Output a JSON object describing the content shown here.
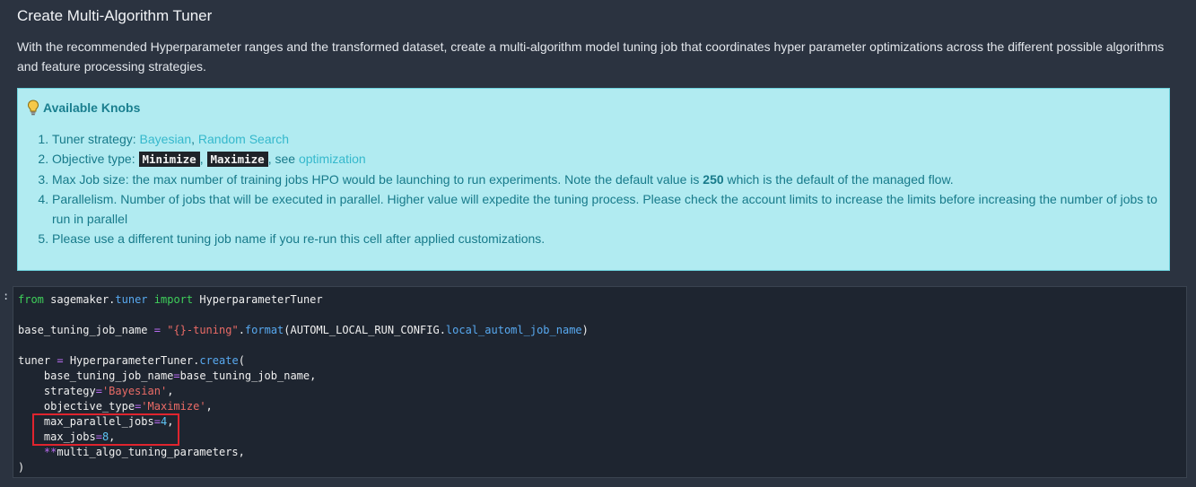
{
  "header": {
    "title": "Create Multi-Algorithm Tuner",
    "description": "With the recommended Hyperparameter ranges and the transformed dataset, create a multi-algorithm model tuning job that coordinates hyper parameter optimizations across the different possible algorithms and feature processing strategies."
  },
  "knobs": {
    "heading": "Available Knobs",
    "item1_label": "Tuner strategy: ",
    "item1_link1": "Bayesian",
    "item1_sep": ", ",
    "item1_link2": "Random Search",
    "item2_label": "Objective type: ",
    "item2_code1": "Minimize",
    "item2_sep": ", ",
    "item2_code2": "Maximize",
    "item2_see": ", see ",
    "item2_link": "optimization",
    "item3_text": "Max Job size: the max number of training jobs HPO would be launching to run experiments. Note the default value is ",
    "item3_bold": "250",
    "item3_tail": " which is the default of the managed flow.",
    "item4_text": "Parallelism. Number of jobs that will be executed in parallel. Higher value will expedite the tuning process. Please check the account limits to increase the limits before increasing the number of jobs to run in parallel",
    "item5_text": "Please use a different tuning job name if you re-run this cell after applied customizations."
  },
  "cell": {
    "prompt": ":",
    "kw_from": "from",
    "mod_sagemaker": "sagemaker",
    "dot": ".",
    "mod_tuner": "tuner",
    "kw_import": "import",
    "cls": "HyperparameterTuner",
    "var_base": "base_tuning_job_name",
    "op_eq": "=",
    "str_fmt": "\"{}-tuning\"",
    "fn_format": "format",
    "cfg": "AUTOML_LOCAL_RUN_CONFIG",
    "attr_job": "local_automl_job_name",
    "var_tuner": "tuner",
    "fn_create": "create",
    "arg_base": "base_tuning_job_name",
    "arg_strategy": "strategy",
    "val_strategy": "'Bayesian'",
    "arg_objective": "objective_type",
    "val_objective": "'Maximize'",
    "arg_parallel": "max_parallel_jobs",
    "val_parallel": "4",
    "arg_maxjobs": "max_jobs",
    "val_maxjobs": "8",
    "op_star": "**",
    "arg_multi": "multi_algo_tuning_parameters",
    "close": ")"
  }
}
